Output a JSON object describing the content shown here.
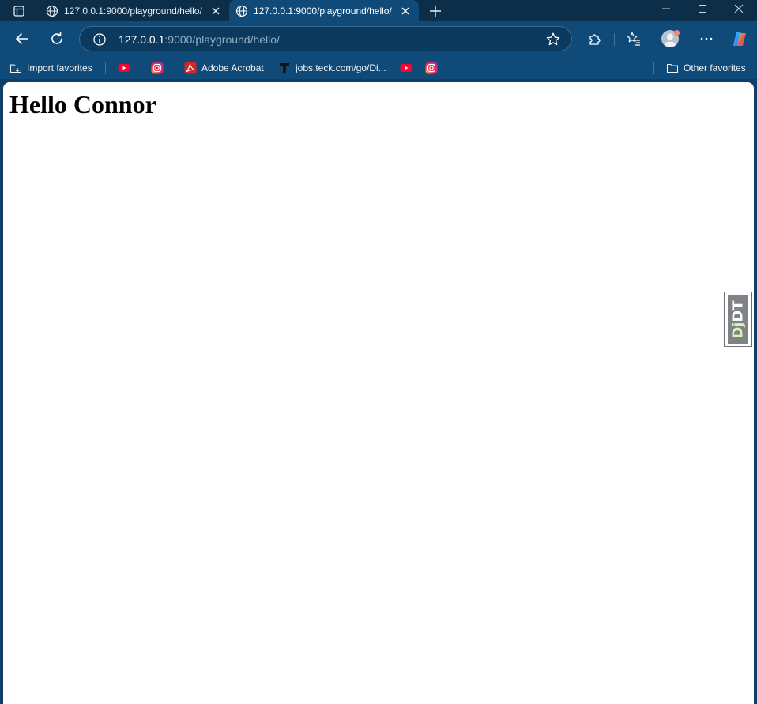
{
  "browser": {
    "tabs": [
      {
        "title": "127.0.0.1:9000/playground/hello/",
        "active": false
      },
      {
        "title": "127.0.0.1:9000/playground/hello/",
        "active": true
      }
    ],
    "address": {
      "host": "127.0.0.1",
      "path": ":9000/playground/hello/"
    },
    "favorites": {
      "import_label": "Import favorites",
      "acrobat_label": "Adobe Acrobat",
      "jobs_label": "jobs.teck.com/go/Di...",
      "other_label": "Other favorites"
    },
    "colors": {
      "frame": "#0d2e48",
      "toolbar": "#0f4a78",
      "youtube": "#ff0033",
      "acrobat": "#d4261f"
    }
  },
  "page": {
    "heading": "Hello Connor"
  },
  "debug_toolbar": {
    "label_dj": "Dj",
    "label_dt": "DT"
  }
}
